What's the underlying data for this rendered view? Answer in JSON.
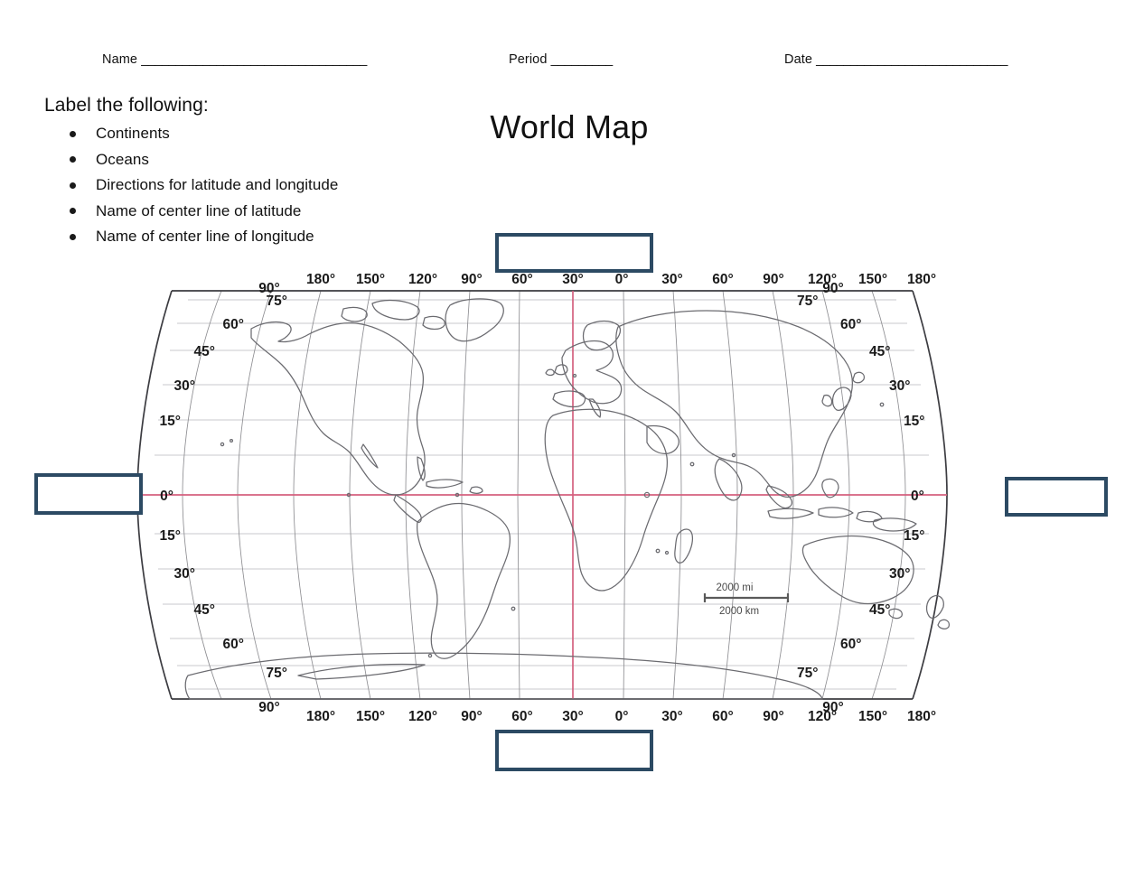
{
  "header": {
    "name_label": "Name",
    "name_rule": "_________________________________",
    "period_label": "Period",
    "period_rule": "_________",
    "date_label": "Date",
    "date_rule": "____________________________"
  },
  "instructions": {
    "title": "Label the following:",
    "items": [
      "Continents",
      "Oceans",
      "Directions for latitude and longitude",
      "Name of center line of latitude",
      "Name of center line of longitude"
    ]
  },
  "map": {
    "title": "World Map",
    "projection": "Robinson",
    "scale": {
      "miles_label": "2000 mi",
      "kilometers_label": "2000 km"
    },
    "colors": {
      "box_border": "#2c4a63",
      "equator_line": "#d4607e",
      "prime_meridian_line": "#d4607e",
      "graticule_meridian": "#8e8e92",
      "graticule_parallel": "#c9c9cd",
      "map_outline": "#3c3c41",
      "coastline": "#6b6b70"
    },
    "longitude_labels_top": [
      "90°",
      "180°",
      "150°",
      "120°",
      "90°",
      "60°",
      "30°",
      "0°",
      "30°",
      "60°",
      "90°",
      "120°",
      "150°",
      "180°",
      "90°"
    ],
    "longitude_labels_bottom": [
      "90°",
      "180°",
      "150°",
      "120°",
      "90°",
      "60°",
      "30°",
      "0°",
      "30°",
      "60°",
      "90°",
      "120°",
      "150°",
      "180°",
      "90°"
    ],
    "latitude_labels_left": [
      "75°",
      "60°",
      "45°",
      "30°",
      "15°",
      "0°",
      "15°",
      "30°",
      "45°",
      "60°",
      "75°"
    ],
    "latitude_labels_right": [
      "75°",
      "60°",
      "45°",
      "30°",
      "15°",
      "0°",
      "15°",
      "30°",
      "45°",
      "60°",
      "75°"
    ]
  },
  "label_boxes": {
    "top": "",
    "bottom": "",
    "left": "",
    "right": ""
  }
}
